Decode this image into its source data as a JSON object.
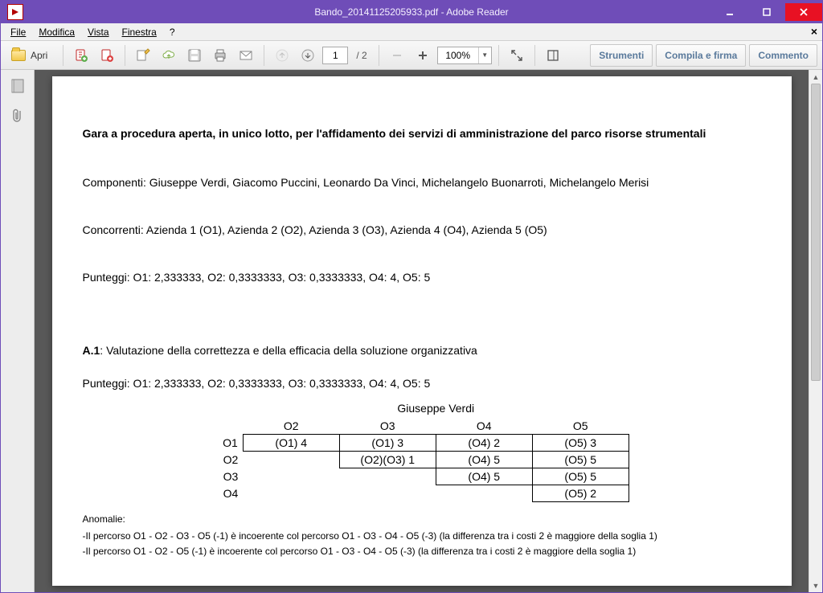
{
  "window": {
    "title": "Bando_20141125205933.pdf - Adobe Reader"
  },
  "menu": {
    "file": "File",
    "edit": "Modifica",
    "view": "Vista",
    "window": "Finestra",
    "help": "?"
  },
  "toolbar": {
    "open": "Apri",
    "page_current": "1",
    "page_total": "/ 2",
    "zoom": "100%"
  },
  "panel": {
    "tools": "Strumenti",
    "fill_sign": "Compila e firma",
    "comment": "Commento"
  },
  "doc": {
    "heading": "Gara a procedura aperta, in unico lotto, per l'affidamento dei servizi di amministrazione del parco risorse strumentali",
    "componenti": "Componenti: Giuseppe Verdi, Giacomo Puccini, Leonardo Da Vinci, Michelangelo Buonarroti, Michelangelo Merisi",
    "concorrenti": "Concorrenti: Azienda 1 (O1), Azienda 2 (O2), Azienda 3 (O3), Azienda 4 (O4), Azienda 5 (O5)",
    "punteggi1": "Punteggi: O1: 2,333333, O2: 0,3333333, O3: 0,3333333, O4: 4, O5: 5",
    "section_code": "A.1",
    "section_rest": ": Valutazione della correttezza e della efficacia della soluzione organizzativa",
    "punteggi2": "Punteggi: O1: 2,333333, O2: 0,3333333, O3: 0,3333333, O4: 4, O5: 5",
    "table": {
      "name": "Giuseppe Verdi",
      "col_heads": [
        "O2",
        "O3",
        "O4",
        "O5"
      ],
      "row_labels": [
        "O1",
        "O2",
        "O3",
        "O4"
      ],
      "cells": {
        "r1": [
          "(O1) 4",
          "(O1) 3",
          "(O4) 2",
          "(O5) 3"
        ],
        "r2": [
          "",
          "(O2)(O3) 1",
          "(O4) 5",
          "(O5) 5"
        ],
        "r3": [
          "",
          "",
          "(O4) 5",
          "(O5) 5"
        ],
        "r4": [
          "",
          "",
          "",
          "(O5) 2"
        ]
      }
    },
    "anomalie_label": "Anomalie:",
    "anomalie1": "-Il percorso O1 - O2 - O3 - O5 (-1) è incoerente col percorso O1 - O3 - O4 - O5 (-3) (la differenza tra i costi 2 è maggiore della soglia 1)",
    "anomalie2": "-Il percorso O1 - O2 - O5 (-1) è incoerente col percorso O1 - O3 - O4 - O5 (-3) (la differenza tra i costi 2 è maggiore della soglia 1)"
  }
}
